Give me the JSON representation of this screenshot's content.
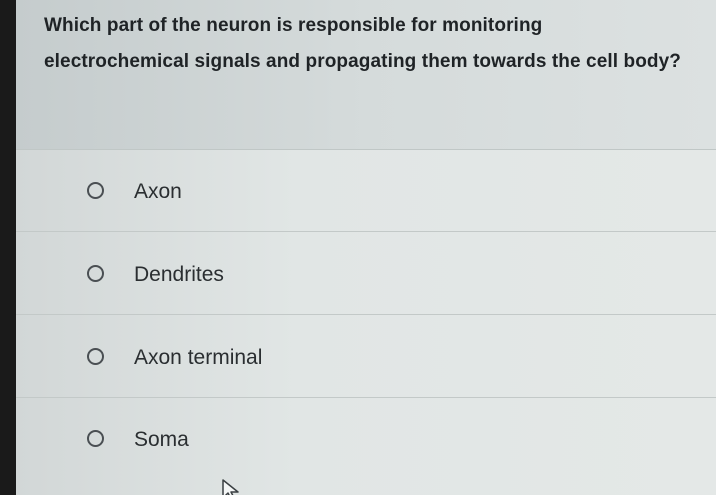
{
  "question": {
    "text": "Which part of the neuron is responsible for monitoring electrochemical signals and propagating them towards the cell body?"
  },
  "options": [
    {
      "label": "Axon",
      "selected": false
    },
    {
      "label": "Dendrites",
      "selected": false
    },
    {
      "label": "Axon terminal",
      "selected": false
    },
    {
      "label": "Soma",
      "selected": false
    }
  ],
  "colors": {
    "question_bg": "#d5dbdb",
    "answer_bg": "#e1e6e5",
    "text": "#1f2326",
    "radio_border": "#4a4f53"
  },
  "icons": [
    "radio-unselected-icon",
    "mouse-pointer-icon"
  ]
}
